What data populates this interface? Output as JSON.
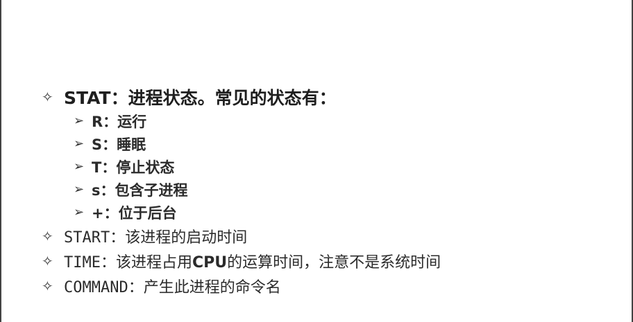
{
  "slide": {
    "items": [
      {
        "bullet": "✧",
        "text": "STAT：进程状态。常见的状态有：",
        "subitems": [
          {
            "bullet": "➢",
            "text": "R：运行"
          },
          {
            "bullet": "➢",
            "text": "S：睡眠"
          },
          {
            "bullet": "➢",
            "text": "T：停止状态"
          },
          {
            "bullet": "➢",
            "text": "s：包含子进程"
          },
          {
            "bullet": "➢",
            "text": "+：位于后台"
          }
        ]
      },
      {
        "bullet": "✧",
        "label": "START",
        "text": "：该进程的启动时间"
      },
      {
        "bullet": "✧",
        "label": "TIME",
        "text_before": "：该进程占用",
        "emphasis": "CPU",
        "text_after": "的运算时间，注意不是系统时间"
      },
      {
        "bullet": "✧",
        "label": "COMMAND",
        "text": "：产生此进程的命令名"
      }
    ]
  }
}
